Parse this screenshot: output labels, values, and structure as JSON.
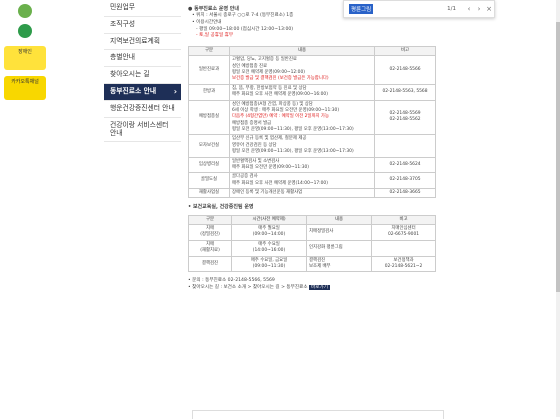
{
  "quick_links": [
    {
      "label": "",
      "color": "#6ab04c"
    },
    {
      "label": "",
      "color": "#2e9b4a"
    },
    {
      "label": "장애인",
      "color": "#ffe23b"
    },
    {
      "label": "카카오톡채널",
      "color": "#f8d700"
    }
  ],
  "sidebar": [
    "민원업무",
    "조직구성",
    "지역보건의료계획",
    "층별안내",
    "찾아오시는 길",
    "동부진료소 안내",
    "행운건강증진센터 안내",
    "건강이랑 서비스센터 안내"
  ],
  "find": {
    "query": "평륜그림",
    "count": "1/1"
  },
  "section_title": "동부진료소 운영 안내",
  "address_line": "위치 : 서울시 종로구 ○○로 7-4 (동부진료소) 1층",
  "operating_title": "이용시간안내",
  "operating_hours": "평일 09:00~18:00 (점심시간 12:00~13:00)",
  "holiday_note": "토,일 공휴일 휴무",
  "table1": {
    "headers": [
      "구분",
      "내용",
      "비고"
    ],
    "rows": [
      {
        "name": "일반진료과",
        "lines": [
          "고혈압, 당뇨, 고지혈증 등 일반진료",
          "성인 예방접종 진료",
          "평일 오전 예약제 운영(09:00~12:00)",
          "보건증 발급 및 결핵검진 (보건증 발급은 가능합니다)"
        ],
        "red": [
          3
        ],
        "note": "02-2148-5566"
      },
      {
        "name": "한방과",
        "lines": [
          "침, 뜸, 부항, 한방보험약 등 진료 및 상담",
          "매주 화요일 오후 사전 예약제 운영(09:00~16:00)"
        ],
        "red": [],
        "note": "02-2148-5563, 5568"
      },
      {
        "name": "예방접종실",
        "lines": [
          "성인 예방접종(A형 간염, 파상풍 등) 및 상담",
          "6세 이상 학생 : 매주 화요일 오전만 운영(09:00~11:30)",
          "다음주 (4형간염만) 예약 : 예약일 이전 2일까지 가능",
          "예방접종 증명서 발급",
          "평일 오전 운영(09:00~11:30), 평일 오후 운영(13:00~17:30)"
        ],
        "red": [
          2
        ],
        "note": "02-2148-5569\n02-2148-5562"
      },
      {
        "name": "모자보건실",
        "lines": [
          "임산부 신규 등록 및 엽산제, 철분제 제공",
          "영유아 건강검진 등 상담",
          "평일 오전 운영(09:00~11:30), 평일 오후 운영(13:00~17:30)"
        ],
        "red": [],
        "note": ""
      },
      {
        "name": "임상병리실",
        "lines": [
          "일반혈액검사 및 소변검사",
          "매주 화요일 오전만 운영(09:00~11:30)"
        ],
        "red": [],
        "note": "02-2148-5624"
      },
      {
        "name": "골밀도실",
        "lines": [
          "골다공증 검사",
          "매주 화요일 오후 사전 예약제 운영(14:00~17:00)"
        ],
        "red": [],
        "note": "02-2148-3705"
      },
      {
        "name": "재활사업실",
        "lines": [
          "장애인 등록 및 기능개선운동 재활사업"
        ],
        "red": [],
        "note": "02-2148-3665"
      }
    ]
  },
  "subsection_title": "보건교육실, 건강증진팀 운영",
  "table2": {
    "headers": [
      "구분",
      "시간(사전 예약제)",
      "내용",
      "비고"
    ],
    "rows": [
      {
        "name": "치매\n(정밀검진)",
        "time": "매주 월요일\n(09:00~14:00)",
        "content": "치매정밀검사",
        "note": "치매안심센터\n02-6675-9001"
      },
      {
        "name": "치매\n(재활치료)",
        "time": "매주 수요일\n(14:00~16:00)",
        "content": "인지강화 평륜그림",
        "note": ""
      },
      {
        "name": "결핵검진",
        "time": "매주 수요일, 금요일\n(09:00~11:30)",
        "content": "결핵검진\n보조제 배부",
        "note": "보건정책과\n02-2148-5621~2"
      }
    ]
  },
  "footer1": "문의 : 동부진료소 02-2148-5566, 5569",
  "footer2": "찾아오시는 길 : 보건소 소개 > 찾아오시는 길 > 동부진료소",
  "footer_button": "바로가기"
}
